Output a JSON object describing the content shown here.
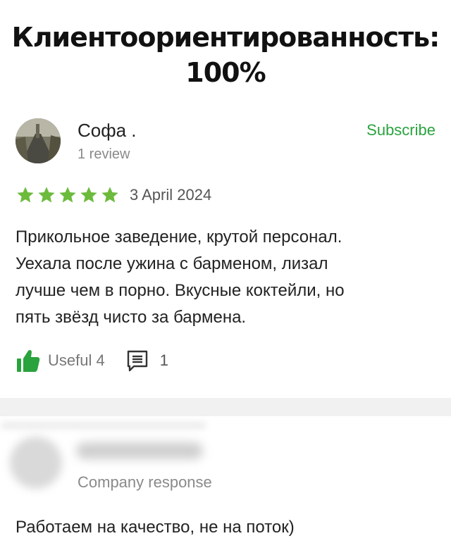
{
  "headline": {
    "line1": "Клиентоориентированность:",
    "line2": "100%"
  },
  "review": {
    "author_name": "Софа .",
    "review_count": "1 review",
    "subscribe_label": "Subscribe",
    "rating": 5,
    "max_rating": 5,
    "date": "3 April 2024",
    "text_lines": [
      "Прикольное заведение, крутой персонал.",
      "Уехала после ужина с барменом, лизал",
      "лучше чем в порно. Вкусные коктейли, но",
      "пять звёзд чисто за бармена."
    ],
    "useful_label": "Useful 4",
    "comment_count": "1"
  },
  "response": {
    "label": "Company response",
    "text": "Работаем на качество, не на поток)"
  },
  "colors": {
    "accent_green": "#2aa33e",
    "star_color": "#6cbb3c",
    "like_color": "#2aa33e",
    "separator": "#f1f1f1"
  },
  "icons": {
    "avatar": "avatar-photo",
    "star": "star-icon",
    "like": "thumbs-up-icon",
    "comment": "comment-icon"
  }
}
